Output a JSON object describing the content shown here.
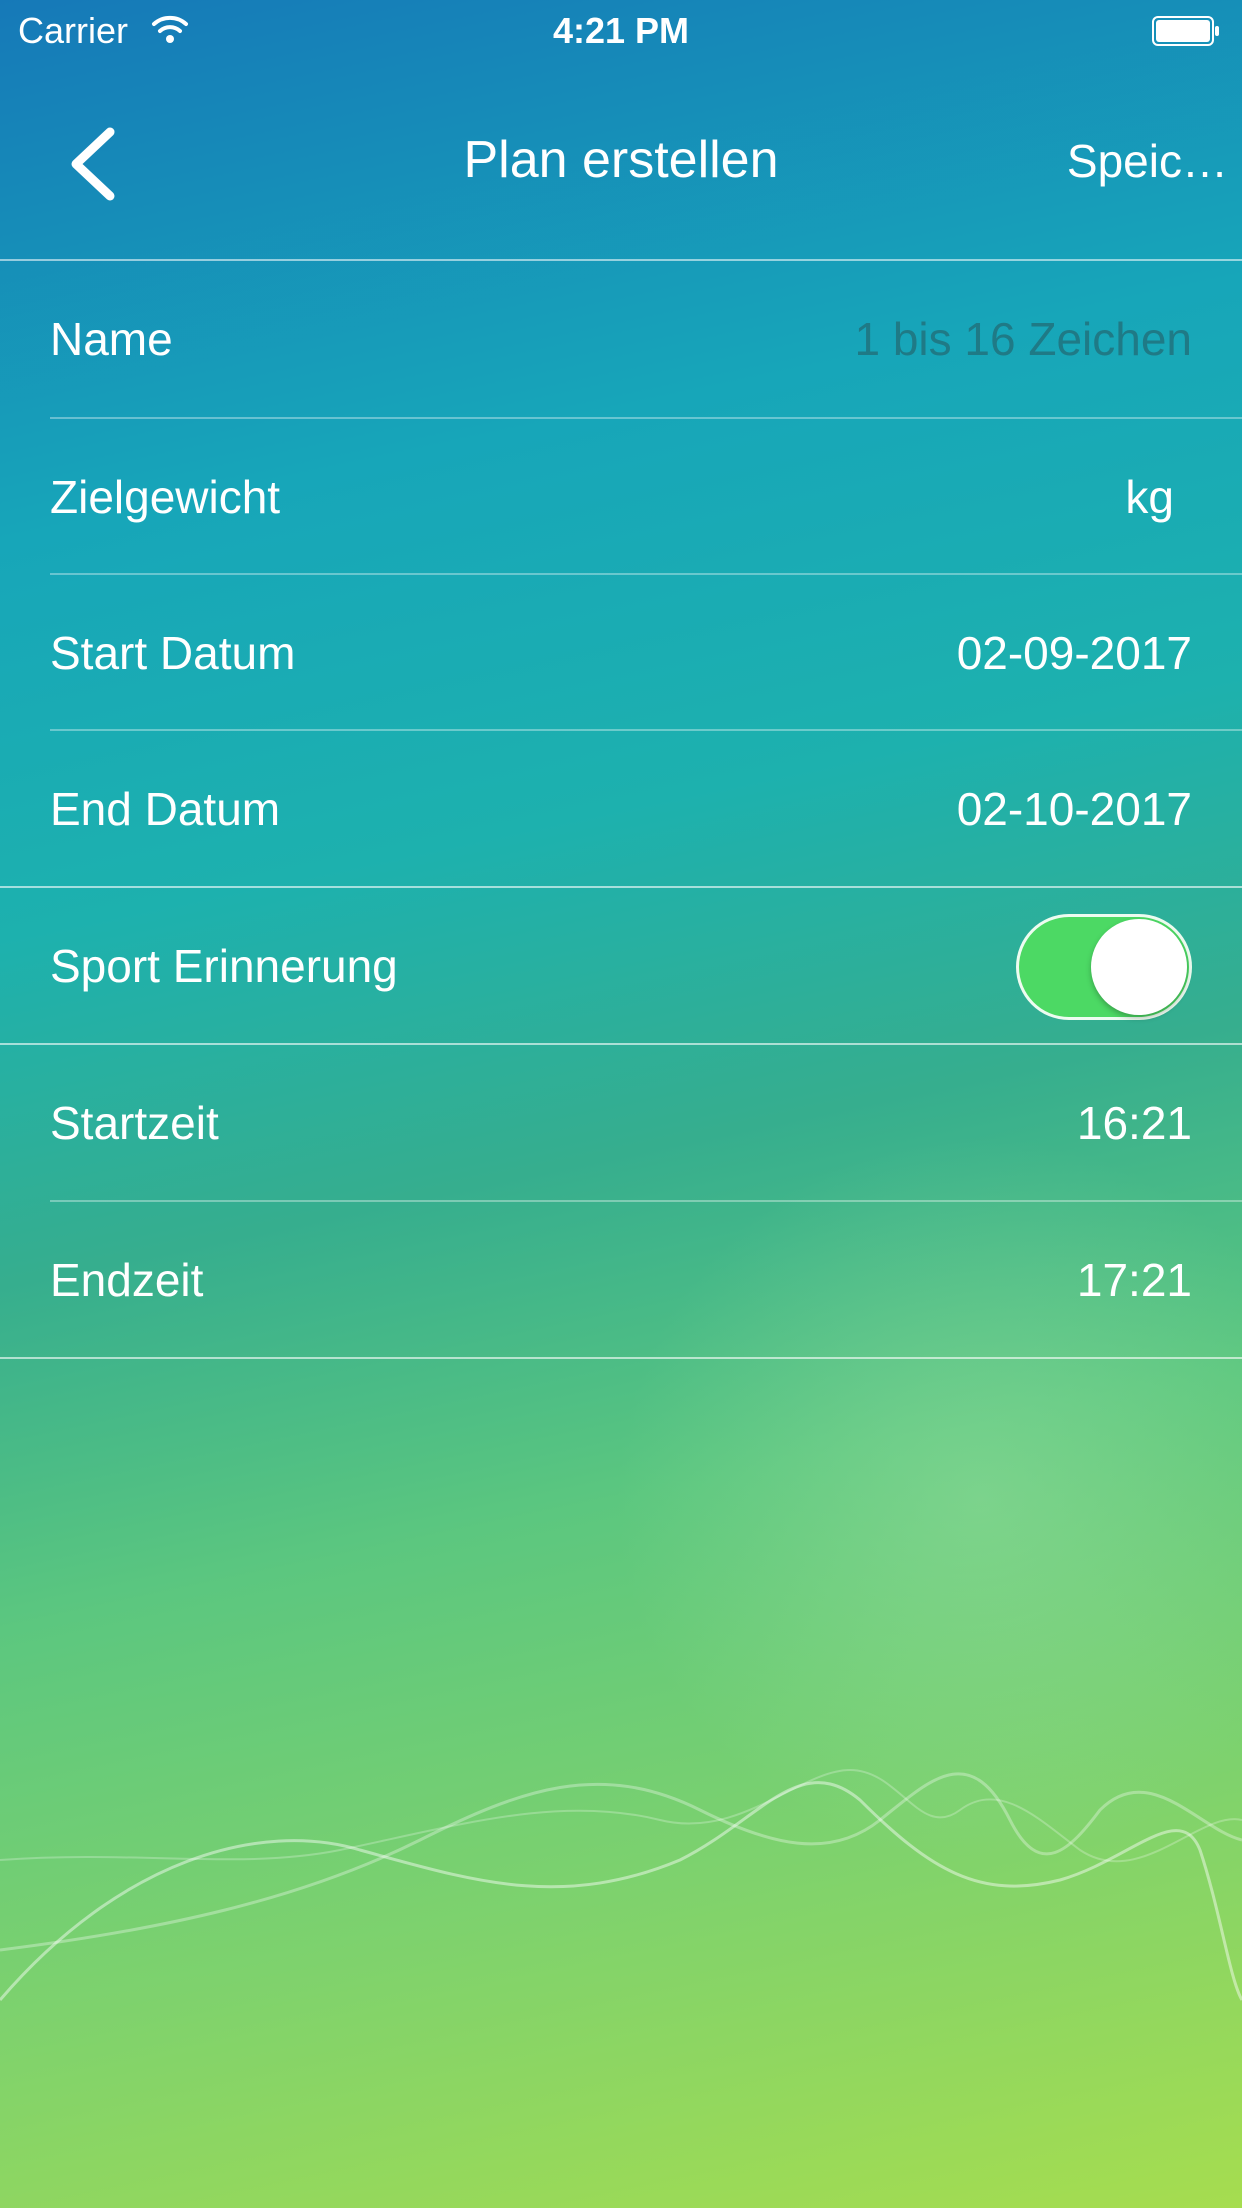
{
  "status_bar": {
    "carrier": "Carrier",
    "time": "4:21 PM"
  },
  "nav": {
    "title": "Plan erstellen",
    "save_label": "Speic…"
  },
  "form": {
    "name": {
      "label": "Name",
      "placeholder": "1 bis 16 Zeichen",
      "value": ""
    },
    "target_weight": {
      "label": "Zielgewicht",
      "unit": "kg",
      "value": ""
    },
    "start_date": {
      "label": "Start Datum",
      "value": "02-09-2017"
    },
    "end_date": {
      "label": "End Datum",
      "value": "02-10-2017"
    },
    "sport_reminder": {
      "label": "Sport Erinnerung",
      "enabled": true
    },
    "start_time": {
      "label": "Startzeit",
      "value": "16:21"
    },
    "end_time": {
      "label": "Endzeit",
      "value": "17:21"
    }
  },
  "colors": {
    "toggle_on": "#4cd964",
    "placeholder": "#1f7a86"
  }
}
